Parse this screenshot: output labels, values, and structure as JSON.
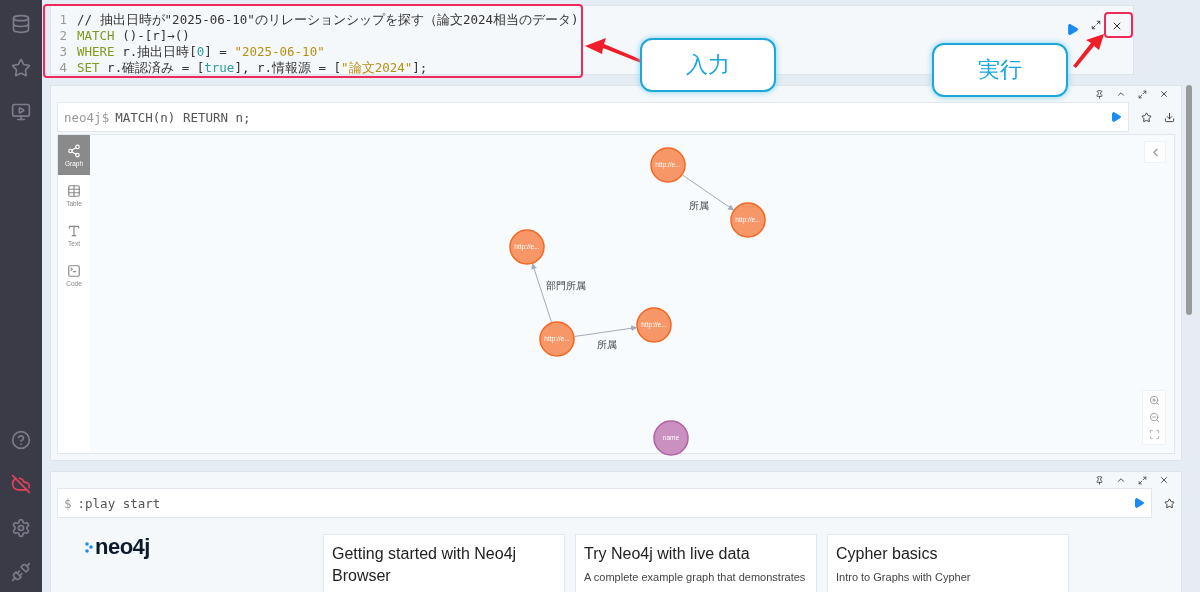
{
  "editor": {
    "lines": [
      {
        "number": "1",
        "tokens": [
          {
            "kind": "comment",
            "text": "// 抽出日時が\"2025-06-10\"のリレーションシップを探す（論文2024相当のデータ)"
          }
        ]
      },
      {
        "number": "2",
        "tokens": [
          {
            "kind": "keyword",
            "text": "MATCH"
          },
          {
            "kind": "plain",
            "text": " ()-[r]→()"
          }
        ]
      },
      {
        "number": "3",
        "tokens": [
          {
            "kind": "keyword",
            "text": "WHERE"
          },
          {
            "kind": "plain",
            "text": " r.抽出日時["
          },
          {
            "kind": "number",
            "text": "0"
          },
          {
            "kind": "plain",
            "text": "] = "
          },
          {
            "kind": "string",
            "text": "\"2025-06-10\""
          }
        ]
      },
      {
        "number": "4",
        "tokens": [
          {
            "kind": "keyword",
            "text": "SET"
          },
          {
            "kind": "plain",
            "text": " r.確認済み = ["
          },
          {
            "kind": "number",
            "text": "true"
          },
          {
            "kind": "plain",
            "text": "], r.情報源 = ["
          },
          {
            "kind": "string",
            "text": "\"論文2024\""
          },
          {
            "kind": "plain",
            "text": "];"
          }
        ]
      }
    ]
  },
  "callouts": [
    {
      "text": "入力"
    },
    {
      "text": "実行"
    }
  ],
  "result": {
    "prompt": "neo4j$",
    "query": "MATCH(n) RETURN n;",
    "views": [
      {
        "label": "Graph",
        "selected": true
      },
      {
        "label": "Table",
        "selected": false
      },
      {
        "label": "Text",
        "selected": false
      },
      {
        "label": "Code",
        "selected": false
      }
    ],
    "nodes": [
      {
        "caption": "http://e...",
        "color": "#f79767"
      },
      {
        "caption": "http://e...",
        "color": "#f79767"
      },
      {
        "caption": "http://e...",
        "color": "#f79767"
      },
      {
        "caption": "http://e...",
        "color": "#f79767"
      },
      {
        "caption": "http://e...",
        "color": "#f79767"
      },
      {
        "caption": "name",
        "color": "#c990c0"
      }
    ],
    "edges": [
      {
        "label": "所属"
      },
      {
        "label": "部門所属"
      },
      {
        "label": "所属"
      }
    ]
  },
  "start": {
    "prompt": "$",
    "query": ":play start",
    "logo": "neo4j",
    "cards": [
      {
        "title": "Getting started with Neo4j Browser"
      },
      {
        "title": "Try Neo4j with live data",
        "subtitle": "A complete example graph that demonstrates"
      },
      {
        "title": "Cypher basics",
        "subtitle": "Intro to Graphs with Cypher"
      }
    ]
  }
}
